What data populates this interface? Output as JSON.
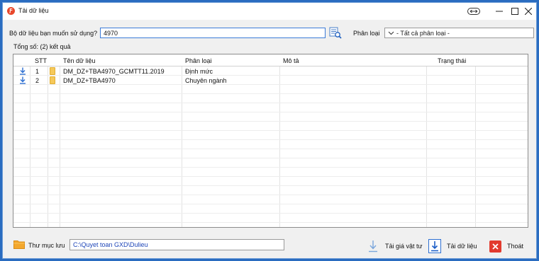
{
  "window": {
    "title": "Tải dữ liệu",
    "app_icon_letter": "Ƒ"
  },
  "search": {
    "label": "Bộ dữ liệu bạn muốn sử dụng?",
    "value": "4970",
    "button_icon": "search-list-icon"
  },
  "filter": {
    "label": "Phân loại",
    "selected": "- Tất cả phân loại -"
  },
  "summary": "Tổng số: (2) kết quả",
  "table": {
    "columns": [
      "STT",
      "Tên dữ liệu",
      "Phân loại",
      "Mô tả",
      "Trạng thái"
    ],
    "rows": [
      {
        "stt": "1",
        "name": "DM_DZ+TBA4970_GCMTT11.2019",
        "category": "Định mức",
        "description": "",
        "status": ""
      },
      {
        "stt": "2",
        "name": "DM_DZ+TBA4970",
        "category": "Chuyên ngành",
        "description": "",
        "status": ""
      }
    ]
  },
  "footer": {
    "folder_label": "Thư mục lưu",
    "folder_path": "C:\\Quyet toan GXD\\Dulieu",
    "btn_load_price": "Tải giá vật tư",
    "btn_load_data": "Tải dữ liệu",
    "btn_exit": "Thoát"
  },
  "colors": {
    "accent": "#2d6fd1",
    "folder": "#f6c95a",
    "exit": "#e23a2e",
    "window_border": "#2a6cc0"
  }
}
